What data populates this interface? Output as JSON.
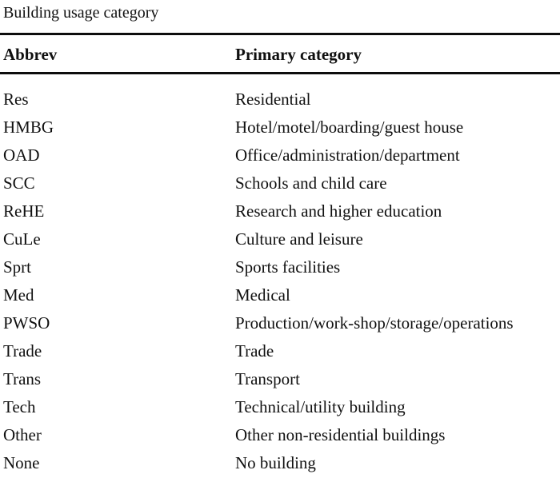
{
  "caption": "Building usage category",
  "table": {
    "columns": [
      {
        "key": "abbrev",
        "label": "Abbrev"
      },
      {
        "key": "category",
        "label": "Primary category"
      }
    ],
    "rows": [
      {
        "abbrev": "Res",
        "category": "Residential"
      },
      {
        "abbrev": "HMBG",
        "category": "Hotel/motel/boarding/guest house"
      },
      {
        "abbrev": "OAD",
        "category": "Office/administration/department"
      },
      {
        "abbrev": "SCC",
        "category": "Schools and child care"
      },
      {
        "abbrev": "ReHE",
        "category": "Research and higher education"
      },
      {
        "abbrev": "CuLe",
        "category": "Culture and leisure"
      },
      {
        "abbrev": "Sprt",
        "category": "Sports facilities"
      },
      {
        "abbrev": "Med",
        "category": "Medical"
      },
      {
        "abbrev": "PWSO",
        "category": "Production/work-shop/storage/operations"
      },
      {
        "abbrev": "Trade",
        "category": "Trade"
      },
      {
        "abbrev": "Trans",
        "category": "Transport"
      },
      {
        "abbrev": "Tech",
        "category": "Technical/utility building"
      },
      {
        "abbrev": "Other",
        "category": "Other non-residential buildings"
      },
      {
        "abbrev": "None",
        "category": "No building"
      }
    ]
  },
  "style": {
    "rule_color": "#0d0d0d",
    "text_color": "#101010",
    "background": "#ffffff"
  }
}
